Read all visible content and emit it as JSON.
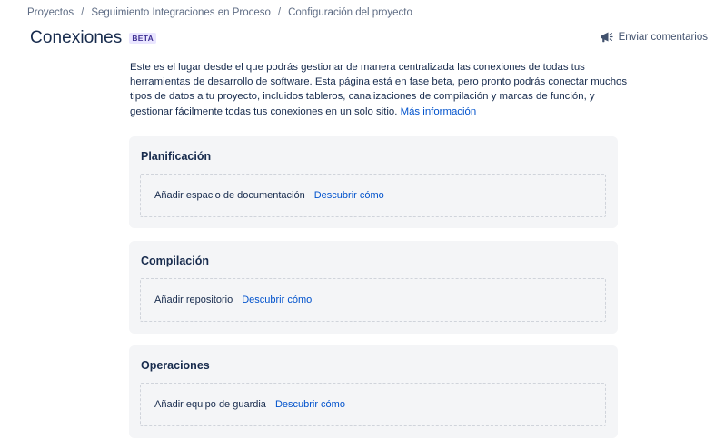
{
  "breadcrumb": [
    "Proyectos",
    "Seguimiento Integraciones en Proceso",
    "Configuración del proyecto"
  ],
  "header": {
    "title": "Conexiones",
    "badge": "BETA",
    "feedback_label": "Enviar comentarios",
    "feedback_icon": "megaphone-icon"
  },
  "intro": {
    "text": "Este es el lugar desde el que podrás gestionar de manera centralizada las conexiones de todas tus herramientas de desarrollo de software. Esta página está en fase beta, pero pronto podrás conectar muchos tipos de datos a tu proyecto, incluidos tableros, canalizaciones de compilación y marcas de función, y gestionar fácilmente todas tus conexiones en un solo sitio.",
    "link": "Más información"
  },
  "cards": [
    {
      "title": "Planificación",
      "item": "Añadir espacio de documentación",
      "link": "Descubrir cómo"
    },
    {
      "title": "Compilación",
      "item": "Añadir repositorio",
      "link": "Descubrir cómo"
    },
    {
      "title": "Operaciones",
      "item": "Añadir equipo de guardia",
      "link": "Descubrir cómo"
    }
  ],
  "colors": {
    "link": "#0052cc",
    "text": "#172b4d",
    "card_bg": "#f4f5f7",
    "badge_bg": "#eae6ff",
    "badge_text": "#403294"
  }
}
